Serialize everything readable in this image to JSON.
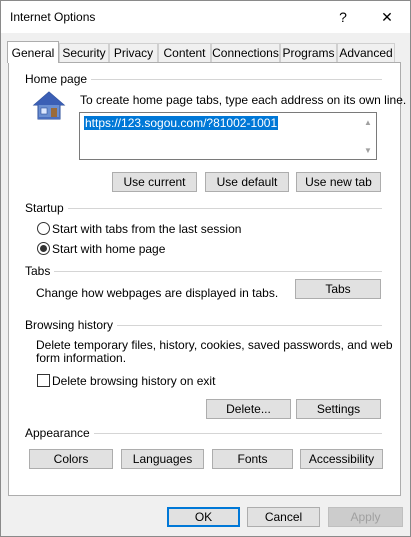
{
  "window": {
    "title": "Internet Options",
    "help_glyph": "?",
    "close_glyph": "✕"
  },
  "tabs": [
    {
      "label": "General",
      "active": true
    },
    {
      "label": "Security"
    },
    {
      "label": "Privacy"
    },
    {
      "label": "Content"
    },
    {
      "label": "Connections"
    },
    {
      "label": "Programs"
    },
    {
      "label": "Advanced"
    }
  ],
  "home_page": {
    "label": "Home page",
    "instructions": "To create home page tabs, type each address on its own line.",
    "url": "https://123.sogou.com/?81002-1001",
    "icon": "house-icon",
    "buttons": {
      "use_current": "Use current",
      "use_default": "Use default",
      "use_new_tab": "Use new tab"
    }
  },
  "startup": {
    "label": "Startup",
    "option_last_session": "Start with tabs from the last session",
    "option_home_page": "Start with home page",
    "selected": "home_page"
  },
  "tabs_section": {
    "label": "Tabs",
    "description": "Change how webpages are displayed in tabs.",
    "button": "Tabs"
  },
  "browsing_history": {
    "label": "Browsing history",
    "description_line1": "Delete temporary files, history, cookies, saved passwords, and web",
    "description_line2": "form information.",
    "delete_on_exit": "Delete browsing history on exit",
    "delete_on_exit_checked": false,
    "buttons": {
      "delete": "Delete...",
      "settings": "Settings"
    }
  },
  "appearance": {
    "label": "Appearance",
    "buttons": {
      "colors": "Colors",
      "languages": "Languages",
      "fonts": "Fonts",
      "accessibility": "Accessibility"
    }
  },
  "footer": {
    "ok": "OK",
    "cancel": "Cancel",
    "apply": "Apply"
  },
  "colors": {
    "selection": "#0078d7",
    "dialog_bg": "#f0f0f0",
    "button_bg": "#e1e1e1"
  }
}
